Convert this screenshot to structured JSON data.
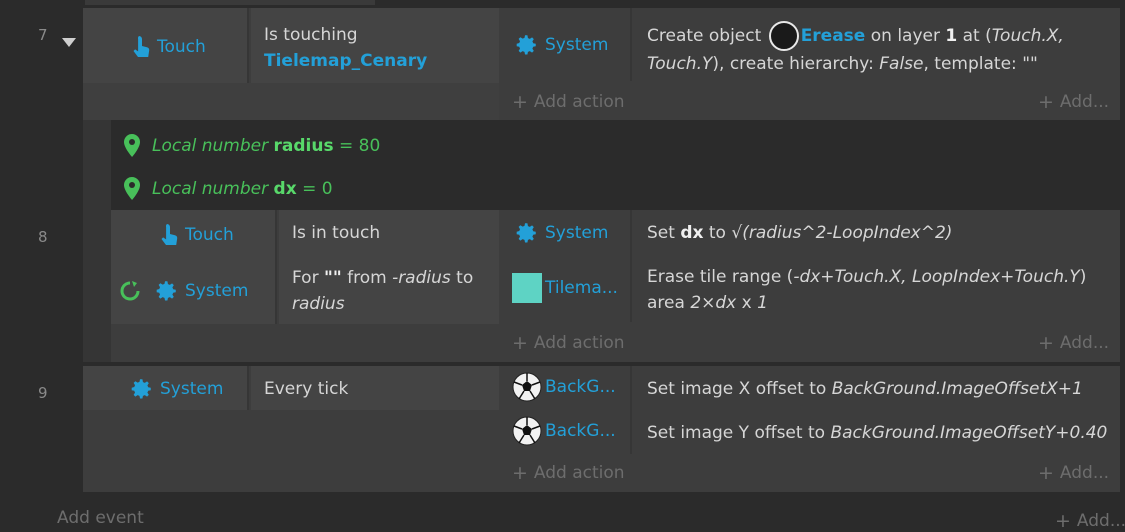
{
  "events": [
    {
      "line": "7",
      "conditions": [
        {
          "object": "Touch",
          "text": "Is touching",
          "target": "Tielemap_Cenary"
        }
      ],
      "actions": [
        {
          "object": "System",
          "text_pre": "Create object",
          "obj_name": "Erease",
          "text_on": "on layer",
          "layer": "1",
          "text_at": "at (",
          "x": "Touch.X,",
          "y": "Touch.Y",
          "text_ch": "), create hierarchy:",
          "hierarchy": "False",
          "text_tpl": ", template:",
          "template": "\"\""
        }
      ],
      "add_action": "Add action",
      "add_more": "Add..."
    },
    {
      "line": "8",
      "locals": [
        {
          "label": "Local number",
          "name": "radius",
          "eq": "=",
          "value": "80"
        },
        {
          "label": "Local number",
          "name": "dx",
          "eq": "=",
          "value": "0"
        }
      ],
      "conditions": [
        {
          "object": "Touch",
          "text": "Is in touch"
        },
        {
          "object": "System",
          "text_pre": "For",
          "quote": "\"\"",
          "text_from": "from",
          "from": "-radius",
          "text_to": "to",
          "to": "radius"
        }
      ],
      "actions": [
        {
          "object": "System",
          "text_pre": "Set",
          "var": "dx",
          "text_to": "to",
          "expr": "√(radius^2-LoopIndex^2)"
        },
        {
          "object": "Tilema...",
          "text_pre": "Erase tile range (",
          "expr1": "-dx+Touch.X, LoopIndex+Touch.Y",
          "text_close": ")",
          "text_area": "area",
          "expr2": "2×dx",
          "text_x": "x",
          "expr3": "1"
        }
      ],
      "add_action": "Add action",
      "add_more": "Add..."
    },
    {
      "line": "9",
      "conditions": [
        {
          "object": "System",
          "text": "Every tick"
        }
      ],
      "actions": [
        {
          "object": "BackG...",
          "text_pre": "Set image X offset to",
          "expr": "BackGround.ImageOffsetX+1"
        },
        {
          "object": "BackG...",
          "text_pre": "Set image Y offset to",
          "expr": "BackGround.ImageOffsetY+0.40"
        }
      ],
      "add_action": "Add action",
      "add_more": "Add..."
    }
  ],
  "footer": {
    "add_event": "Add event",
    "add_more": "Add..."
  },
  "colors": {
    "link": "#23a0d8",
    "local": "#48c05a",
    "background": "#2b2b2b",
    "block": "#3d3d3d"
  }
}
